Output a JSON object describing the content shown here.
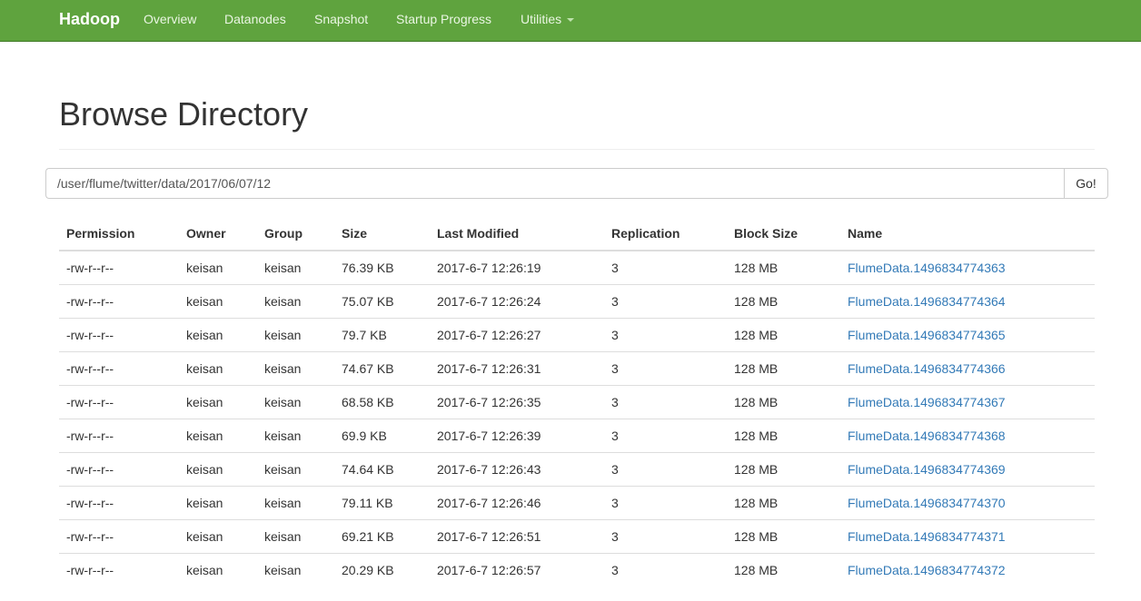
{
  "navbar": {
    "brand": "Hadoop",
    "items": [
      {
        "label": "Overview"
      },
      {
        "label": "Datanodes"
      },
      {
        "label": "Snapshot"
      },
      {
        "label": "Startup Progress"
      },
      {
        "label": "Utilities"
      }
    ]
  },
  "page": {
    "title": "Browse Directory"
  },
  "path": {
    "value": "/user/flume/twitter/data/2017/06/07/12",
    "go_label": "Go!"
  },
  "table": {
    "headers": [
      "Permission",
      "Owner",
      "Group",
      "Size",
      "Last Modified",
      "Replication",
      "Block Size",
      "Name"
    ],
    "rows": [
      [
        "-rw-r--r--",
        "keisan",
        "keisan",
        "76.39 KB",
        "2017-6-7 12:26:19",
        "3",
        "128 MB",
        "FlumeData.1496834774363"
      ],
      [
        "-rw-r--r--",
        "keisan",
        "keisan",
        "75.07 KB",
        "2017-6-7 12:26:24",
        "3",
        "128 MB",
        "FlumeData.1496834774364"
      ],
      [
        "-rw-r--r--",
        "keisan",
        "keisan",
        "79.7 KB",
        "2017-6-7 12:26:27",
        "3",
        "128 MB",
        "FlumeData.1496834774365"
      ],
      [
        "-rw-r--r--",
        "keisan",
        "keisan",
        "74.67 KB",
        "2017-6-7 12:26:31",
        "3",
        "128 MB",
        "FlumeData.1496834774366"
      ],
      [
        "-rw-r--r--",
        "keisan",
        "keisan",
        "68.58 KB",
        "2017-6-7 12:26:35",
        "3",
        "128 MB",
        "FlumeData.1496834774367"
      ],
      [
        "-rw-r--r--",
        "keisan",
        "keisan",
        "69.9 KB",
        "2017-6-7 12:26:39",
        "3",
        "128 MB",
        "FlumeData.1496834774368"
      ],
      [
        "-rw-r--r--",
        "keisan",
        "keisan",
        "74.64 KB",
        "2017-6-7 12:26:43",
        "3",
        "128 MB",
        "FlumeData.1496834774369"
      ],
      [
        "-rw-r--r--",
        "keisan",
        "keisan",
        "79.11 KB",
        "2017-6-7 12:26:46",
        "3",
        "128 MB",
        "FlumeData.1496834774370"
      ],
      [
        "-rw-r--r--",
        "keisan",
        "keisan",
        "69.21 KB",
        "2017-6-7 12:26:51",
        "3",
        "128 MB",
        "FlumeData.1496834774371"
      ],
      [
        "-rw-r--r--",
        "keisan",
        "keisan",
        "20.29 KB",
        "2017-6-7 12:26:57",
        "3",
        "128 MB",
        "FlumeData.1496834774372"
      ]
    ]
  },
  "colors": {
    "navbar_bg": "#5fa33e",
    "link": "#337ab7"
  }
}
